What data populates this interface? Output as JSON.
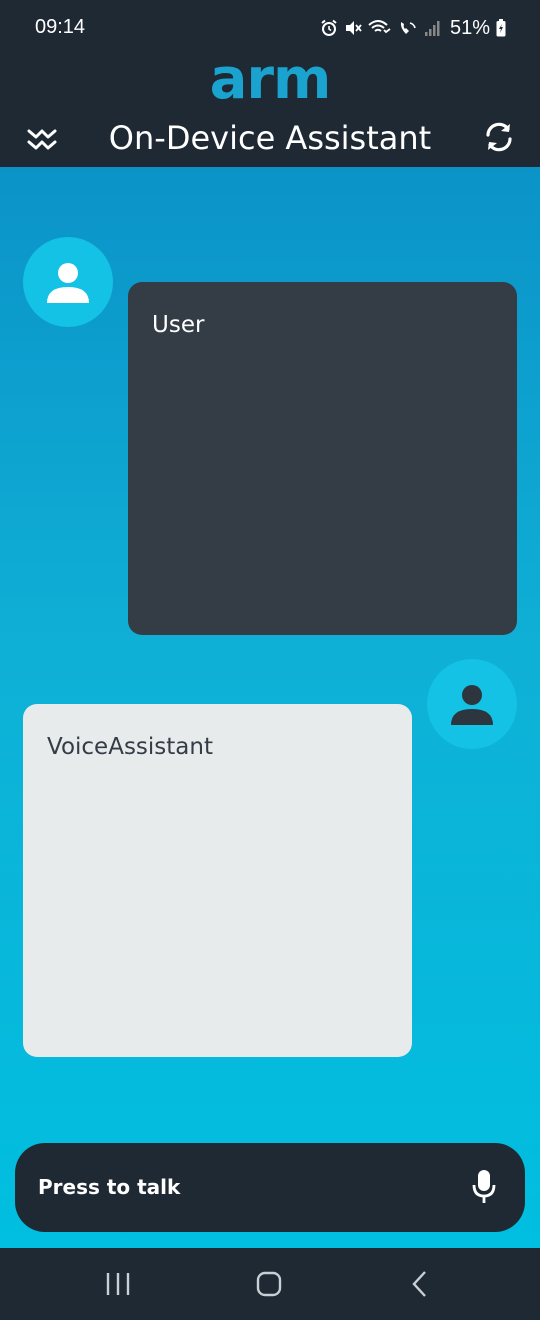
{
  "status_bar": {
    "time": "09:14",
    "battery": "51%",
    "icons": [
      "alarm-icon",
      "mute-icon",
      "wifi-calling-icon",
      "volte-icon",
      "signal-icon",
      "battery-icon"
    ]
  },
  "header": {
    "logo": "arm",
    "title": "On-Device Assistant",
    "left_icon": "expand-icon",
    "right_icon": "refresh-icon"
  },
  "chat": {
    "messages": [
      {
        "role": "user",
        "label": "User",
        "avatar_icon": "person-icon"
      },
      {
        "role": "assistant",
        "label": "VoiceAssistant",
        "avatar_icon": "person-icon"
      }
    ]
  },
  "input": {
    "label": "Press to talk",
    "icon": "microphone-icon"
  },
  "nav": {
    "buttons": [
      "recent-apps-icon",
      "home-icon",
      "back-icon"
    ]
  },
  "colors": {
    "header_bg": "#1f2933",
    "logo": "#1aa3cf",
    "chat_top": "#0b93c8",
    "chat_bottom": "#00bfe0",
    "avatar_bg": "#13c2e4",
    "user_bubble": "#343d46",
    "assistant_bubble": "#e7ebeb"
  }
}
